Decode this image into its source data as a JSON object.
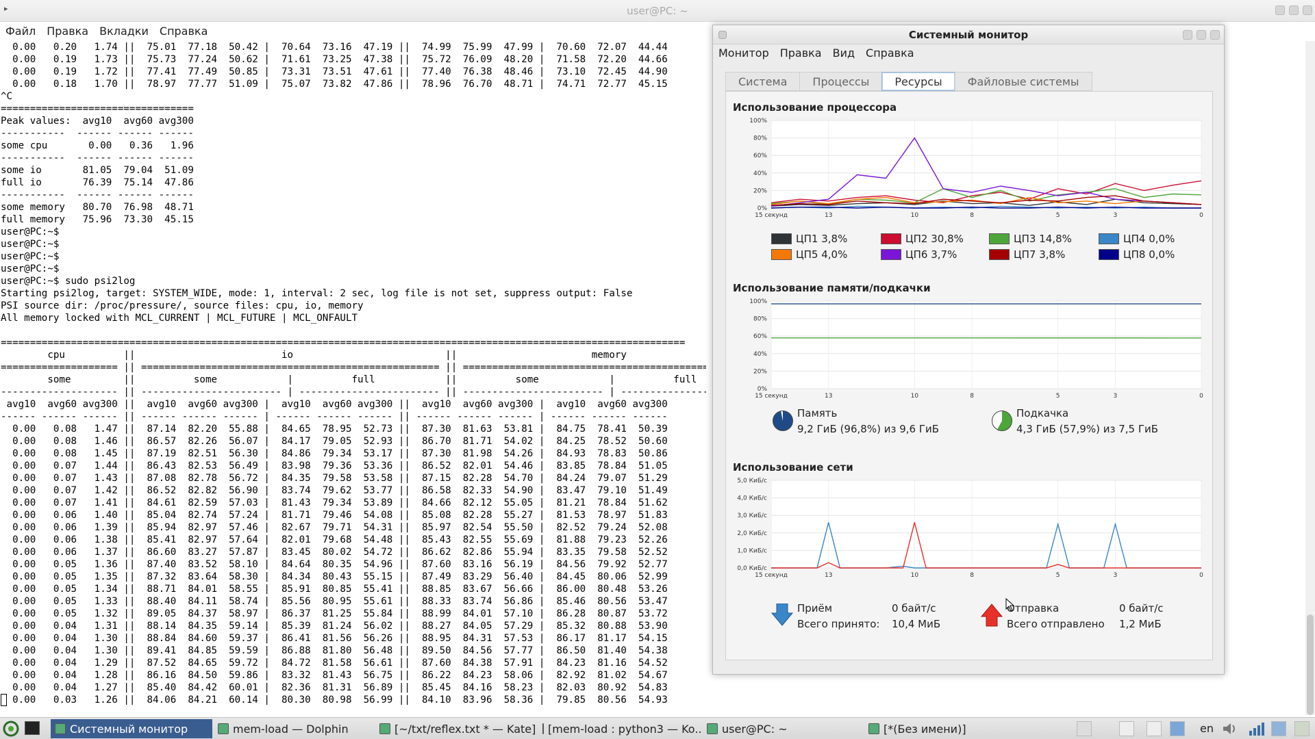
{
  "terminal": {
    "title": "user@PC: ~",
    "menu": [
      "Файл",
      "Правка",
      "Вкладки",
      "Справка"
    ],
    "lines": [
      "  0.00   0.20   1.74 ||  75.01  77.18  50.42 |  70.64  73.16  47.19 ||  74.99  75.99  47.99 |  70.60  72.07  44.44",
      "  0.00   0.19   1.73 ||  75.73  77.24  50.62 |  71.61  73.25  47.38 ||  75.72  76.09  48.20 |  71.58  72.20  44.66",
      "  0.00   0.19   1.72 ||  77.41  77.49  50.85 |  73.31  73.51  47.61 ||  77.40  76.38  48.46 |  73.10  72.45  44.90",
      "  0.00   0.18   1.70 ||  78.97  77.77  51.09 |  75.07  73.82  47.86 ||  78.96  76.70  48.71 |  74.71  72.77  45.15",
      "^C",
      "=================================",
      "Peak values:  avg10  avg60 avg300",
      "-----------  ------ ------ ------",
      "some cpu       0.00   0.36   1.96",
      "-----------  ------ ------ ------",
      "some io       81.05  79.04  51.09",
      "full io       76.39  75.14  47.86",
      "-----------  ------ ------ ------",
      "some memory   80.70  76.98  48.71",
      "full memory   75.96  73.30  45.15",
      "user@PC:~$",
      "user@PC:~$",
      "user@PC:~$",
      "user@PC:~$",
      "user@PC:~$ sudo psi2log",
      "Starting psi2log, target: SYSTEM_WIDE, mode: 1, interval: 2 sec, log file is not set, suppress output: False",
      "PSI source dir: /proc/pressure/, source files: cpu, io, memory",
      "All memory locked with MCL_CURRENT | MCL_FUTURE | MCL_ONFAULT",
      "",
      "=====================================================================================================================",
      "        cpu          ||                         io                          ||                       memory",
      "==================== || =================================================== || ===================================================",
      "        some         ||          some            |          full            ||          some            |          full",
      "-------------------- || ------------------------ | ------------------------ || ------------------------ | ------------------------",
      " avg10  avg60 avg300 ||  avg10  avg60 avg300 |  avg10  avg60 avg300 ||  avg10  avg60 avg300 |  avg10  avg60 avg300",
      "------ ------ ------ || ------ ------ ------ | ------ ------ ------ || ------ ------ ------ | ------ ------ ------",
      "  0.00   0.08   1.47 ||  87.14  82.20  55.88 |  84.65  78.95  52.73 ||  87.30  81.63  53.81 |  84.75  78.41  50.39",
      "  0.00   0.08   1.46 ||  86.57  82.26  56.07 |  84.17  79.05  52.93 ||  86.70  81.71  54.02 |  84.25  78.52  50.60",
      "  0.00   0.08   1.45 ||  87.19  82.51  56.30 |  84.86  79.34  53.17 ||  87.30  81.98  54.26 |  84.93  78.83  50.86",
      "  0.00   0.07   1.44 ||  86.43  82.53  56.49 |  83.98  79.36  53.36 ||  86.52  82.01  54.46 |  83.85  78.84  51.05",
      "  0.00   0.07   1.43 ||  87.08  82.78  56.72 |  84.35  79.58  53.58 ||  87.15  82.28  54.70 |  84.24  79.07  51.29",
      "  0.00   0.07   1.42 ||  86.52  82.82  56.90 |  83.74  79.62  53.77 ||  86.58  82.33  54.90 |  83.47  79.10  51.49",
      "  0.00   0.07   1.41 ||  84.61  82.59  57.03 |  81.43  79.34  53.89 ||  84.66  82.12  55.05 |  81.21  78.84  51.62",
      "  0.00   0.06   1.40 ||  85.04  82.74  57.24 |  81.71  79.46  54.08 ||  85.08  82.28  55.27 |  81.53  78.97  51.83",
      "  0.00   0.06   1.39 ||  85.94  82.97  57.46 |  82.67  79.71  54.31 ||  85.97  82.54  55.50 |  82.52  79.24  52.08",
      "  0.00   0.06   1.38 ||  85.41  82.97  57.64 |  82.01  79.68  54.48 ||  85.43  82.55  55.69 |  81.88  79.23  52.26",
      "  0.00   0.06   1.37 ||  86.60  83.27  57.87 |  83.45  80.02  54.72 ||  86.62  82.86  55.94 |  83.35  79.58  52.52",
      "  0.00   0.05   1.36 ||  87.40  83.52  58.10 |  84.64  80.35  54.96 ||  87.60  83.16  56.19 |  84.56  79.92  52.77",
      "  0.00   0.05   1.35 ||  87.32  83.64  58.30 |  84.34  80.43  55.15 ||  87.49  83.29  56.40 |  84.45  80.06  52.99",
      "  0.00   0.05   1.34 ||  88.71  84.01  58.55 |  85.91  80.85  55.41 ||  88.85  83.67  56.66 |  86.00  80.48  53.26",
      "  0.00   0.05   1.33 ||  88.40  84.11  58.74 |  85.56  80.95  55.61 ||  88.33  83.74  56.86 |  85.46  80.56  53.47",
      "  0.00   0.05   1.32 ||  89.05  84.37  58.97 |  86.37  81.25  55.84 ||  88.99  84.01  57.10 |  86.28  80.87  53.72",
      "  0.00   0.04   1.31 ||  88.14  84.35  59.14 |  85.39  81.24  56.02 ||  88.27  84.05  57.29 |  85.32  80.88  53.90",
      "  0.00   0.04   1.30 ||  88.84  84.60  59.37 |  86.41  81.56  56.26 ||  88.95  84.31  57.53 |  86.17  81.17  54.15",
      "  0.00   0.04   1.30 ||  89.41  84.85  59.59 |  86.88  81.80  56.48 ||  89.50  84.56  57.77 |  86.50  81.40  54.38",
      "  0.00   0.04   1.29 ||  87.52  84.65  59.72 |  84.72  81.58  56.61 ||  87.60  84.38  57.91 |  84.23  81.16  54.52",
      "  0.00   0.04   1.28 ||  86.16  84.50  59.86 |  83.32  81.43  56.75 ||  86.22  84.23  58.06 |  82.92  81.02  54.67",
      "  0.00   0.04   1.27 ||  85.40  84.42  60.01 |  82.36  81.31  56.89 ||  85.45  84.16  58.23 |  82.03  80.92  54.83",
      "  0.00   0.03   1.26 ||  84.06  84.21  60.14 |  80.30  80.98  56.99 ||  84.10  83.96  58.36 |  79.85  80.56  54.93"
    ]
  },
  "sysmon": {
    "title": "Системный монитор",
    "menu": [
      "Монитор",
      "Правка",
      "Вид",
      "Справка"
    ],
    "tabs": [
      "Система",
      "Процессы",
      "Ресурсы",
      "Файловые системы"
    ],
    "active_tab": "Ресурсы",
    "cpu": {
      "title": "Использование процессора",
      "y_ticks": [
        "100%",
        "80%",
        "60%",
        "40%",
        "20%",
        "0%"
      ],
      "x_ticks": [
        "15 секунд",
        "13",
        "10",
        "8",
        "5",
        "3",
        "0"
      ],
      "legend": [
        {
          "label": "ЦП1 3,8%",
          "color": "#2e3436"
        },
        {
          "label": "ЦП2 30,8%",
          "color": "#cc0c30"
        },
        {
          "label": "ЦП3 14,8%",
          "color": "#4ea63a"
        },
        {
          "label": "ЦП4 0,0%",
          "color": "#3a86c8"
        },
        {
          "label": "ЦП5 4,0%",
          "color": "#f57900"
        },
        {
          "label": "ЦП6 3,7%",
          "color": "#7b16d6"
        },
        {
          "label": "ЦП7 3,8%",
          "color": "#a40000"
        },
        {
          "label": "ЦП8 0,0%",
          "color": "#00008b"
        }
      ]
    },
    "memory": {
      "title": "Использование памяти/подкачки",
      "y_ticks": [
        "100%",
        "80%",
        "60%",
        "40%",
        "20%",
        "0%"
      ],
      "x_ticks": [
        "15 секунд",
        "13",
        "10",
        "8",
        "5",
        "3",
        "0"
      ],
      "mem_label": "Память",
      "mem_value": "9,2 ГиБ (96,8%) из 9,6 ГиБ",
      "swap_label": "Подкачка",
      "swap_value": "4,3 ГиБ (57,9%) из 7,5 ГиБ",
      "mem_color": "#204a87",
      "swap_color": "#4ea63a"
    },
    "network": {
      "title": "Использование сети",
      "y_ticks": [
        "5,0 КиБ/с",
        "4,0 КиБ/с",
        "3,0 КиБ/с",
        "2,0 КиБ/с",
        "1,0 КиБ/с",
        "0,0 КиБ/с"
      ],
      "x_ticks": [
        "15 секунд",
        "13",
        "10",
        "8",
        "5",
        "3",
        "0"
      ],
      "recv_label": "Приём",
      "recv_rate": "0 байт/с",
      "recv_total_label": "Всего принято:",
      "recv_total": "10,4 МиБ",
      "send_label": "Отправка",
      "send_rate": "0 байт/с",
      "send_total_label": "Всего отправлено",
      "send_total": "1,2 МиБ",
      "recv_color": "#3a86c8",
      "send_color": "#e8302a"
    }
  },
  "chart_data": [
    {
      "type": "line",
      "title": "Использование процессора",
      "xlabel": "",
      "ylabel": "",
      "x": [
        15,
        14,
        13,
        12,
        11,
        10,
        9,
        8,
        7,
        6,
        5,
        4,
        3,
        2,
        1,
        0
      ],
      "ylim": [
        0,
        100
      ],
      "series": [
        {
          "name": "ЦП1 3,8%",
          "values": [
            2,
            4,
            3,
            5,
            6,
            4,
            8,
            5,
            6,
            3,
            7,
            4,
            10,
            6,
            5,
            4
          ]
        },
        {
          "name": "ЦП2 30,8%",
          "values": [
            6,
            10,
            8,
            12,
            14,
            9,
            6,
            14,
            18,
            10,
            22,
            16,
            28,
            20,
            26,
            31
          ]
        },
        {
          "name": "ЦП3 14,8%",
          "values": [
            5,
            8,
            4,
            10,
            9,
            6,
            22,
            12,
            20,
            8,
            15,
            18,
            22,
            12,
            16,
            15
          ]
        },
        {
          "name": "ЦП4 0,0%",
          "values": [
            0,
            1,
            0,
            2,
            1,
            0,
            1,
            0,
            2,
            1,
            0,
            1,
            0,
            1,
            0,
            0
          ]
        },
        {
          "name": "ЦП5 4,0%",
          "values": [
            4,
            8,
            5,
            10,
            12,
            6,
            7,
            9,
            5,
            12,
            6,
            8,
            5,
            8,
            6,
            4
          ]
        },
        {
          "name": "ЦП6 3,7%",
          "values": [
            2,
            6,
            10,
            38,
            34,
            80,
            22,
            18,
            25,
            20,
            14,
            18,
            10,
            8,
            6,
            4
          ]
        },
        {
          "name": "ЦП7 3,8%",
          "values": [
            3,
            5,
            4,
            8,
            6,
            5,
            10,
            8,
            6,
            9,
            8,
            12,
            14,
            8,
            6,
            4
          ]
        },
        {
          "name": "ЦП8 0,0%",
          "values": [
            0,
            1,
            1,
            0,
            1,
            0,
            0,
            1,
            0,
            0,
            1,
            0,
            1,
            0,
            0,
            0
          ]
        }
      ]
    },
    {
      "type": "line",
      "title": "Использование памяти/подкачки",
      "xlabel": "",
      "ylabel": "",
      "x": [
        15,
        0
      ],
      "ylim": [
        0,
        100
      ],
      "series": [
        {
          "name": "Память",
          "values": [
            96.8,
            96.8
          ]
        },
        {
          "name": "Подкачка",
          "values": [
            58,
            57.9
          ]
        }
      ]
    },
    {
      "type": "line",
      "title": "Использование сети",
      "xlabel": "",
      "ylabel": "",
      "x": [
        15,
        14,
        13.4,
        13,
        12.6,
        12,
        11,
        10.4,
        10,
        9.6,
        9,
        8,
        7,
        6,
        5.4,
        5,
        4.6,
        4,
        3.4,
        3,
        2.6,
        2,
        1,
        0
      ],
      "ylim": [
        0,
        5
      ],
      "series": [
        {
          "name": "Приём",
          "values": [
            0,
            0,
            0,
            2.6,
            0,
            0,
            0,
            0.1,
            0,
            0,
            0,
            0,
            0,
            0,
            0,
            2.5,
            0,
            0,
            0,
            2.5,
            0,
            0,
            0,
            0
          ]
        },
        {
          "name": "Отправка",
          "values": [
            0,
            0,
            0,
            0.3,
            0,
            0,
            0,
            0,
            2.6,
            0,
            0,
            0,
            0,
            0,
            0,
            0.2,
            0,
            0,
            0,
            0,
            0,
            0,
            0,
            0
          ]
        }
      ]
    }
  ],
  "taskbar": {
    "tasks": [
      {
        "label": "Системный монитор",
        "active": true
      },
      {
        "label": "mem-load — Dolphin",
        "active": false
      },
      {
        "label": "[~/txt/reflex.txt * — Kate]",
        "active": false
      },
      {
        "label": "[mem-load : python3 — Ko...",
        "active": false
      },
      {
        "label": "user@PC: ~",
        "active": false
      },
      {
        "label": "[*(Без имени)]",
        "active": false
      }
    ],
    "lang": "en"
  }
}
